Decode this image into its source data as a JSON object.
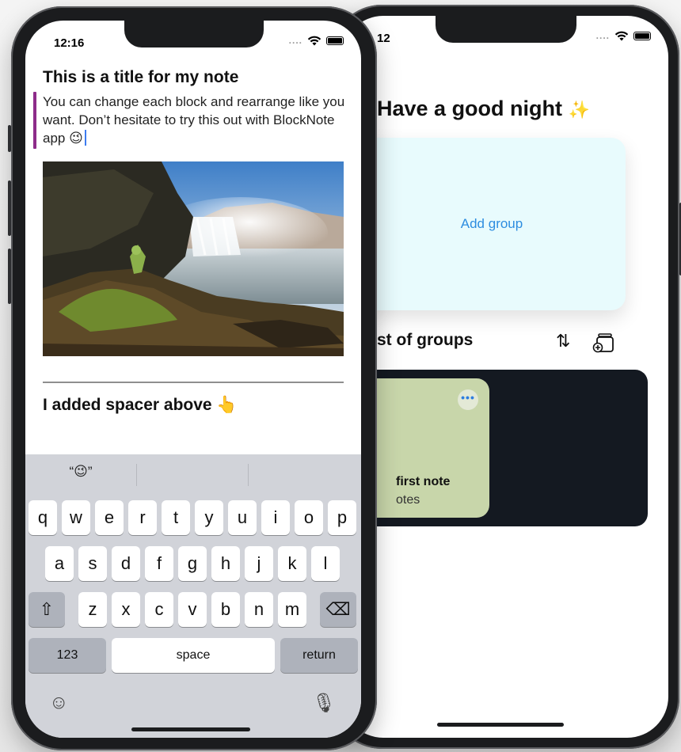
{
  "back_screen": {
    "status": {
      "time": "12",
      "signal": "....",
      "wifi_icon": "wifi-icon",
      "battery_icon": "battery-icon"
    },
    "greeting": "Have a good night",
    "greeting_emoji": "✨",
    "add_group_label": "Add group",
    "list_header": "st of groups",
    "sort_icon": "⇅",
    "new_group_icon": "new-group-icon",
    "note_card": {
      "more_label": "•••",
      "name": "first note",
      "count": "otes",
      "color": "#c8d6aa"
    },
    "panel_color": "#141921",
    "accent_color": "#2d8de0"
  },
  "front_screen": {
    "status": {
      "time": "12:16",
      "signal": "....",
      "wifi_icon": "wifi-icon",
      "battery_icon": "battery-icon"
    },
    "note_title": "This is a title for my note",
    "note_body": "You can change each block and rearrange like you want. Don’t hesitate to try this out with BlockNote app 😉",
    "spacer_text": "I added spacer above 👆",
    "block_accent_color": "#8e2c8a",
    "keyboard": {
      "suggestions": [
        "“😉”",
        "",
        ""
      ],
      "row1": [
        "q",
        "w",
        "e",
        "r",
        "t",
        "y",
        "u",
        "i",
        "o",
        "p"
      ],
      "row2": [
        "a",
        "s",
        "d",
        "f",
        "g",
        "h",
        "j",
        "k",
        "l"
      ],
      "row3": [
        "z",
        "x",
        "c",
        "v",
        "b",
        "n",
        "m"
      ],
      "shift_label": "⇧",
      "delete_label": "⌫",
      "numbers_label": "123",
      "space_label": "space",
      "return_label": "return",
      "emoji_label": "☺",
      "mic_label": "🎙"
    }
  }
}
